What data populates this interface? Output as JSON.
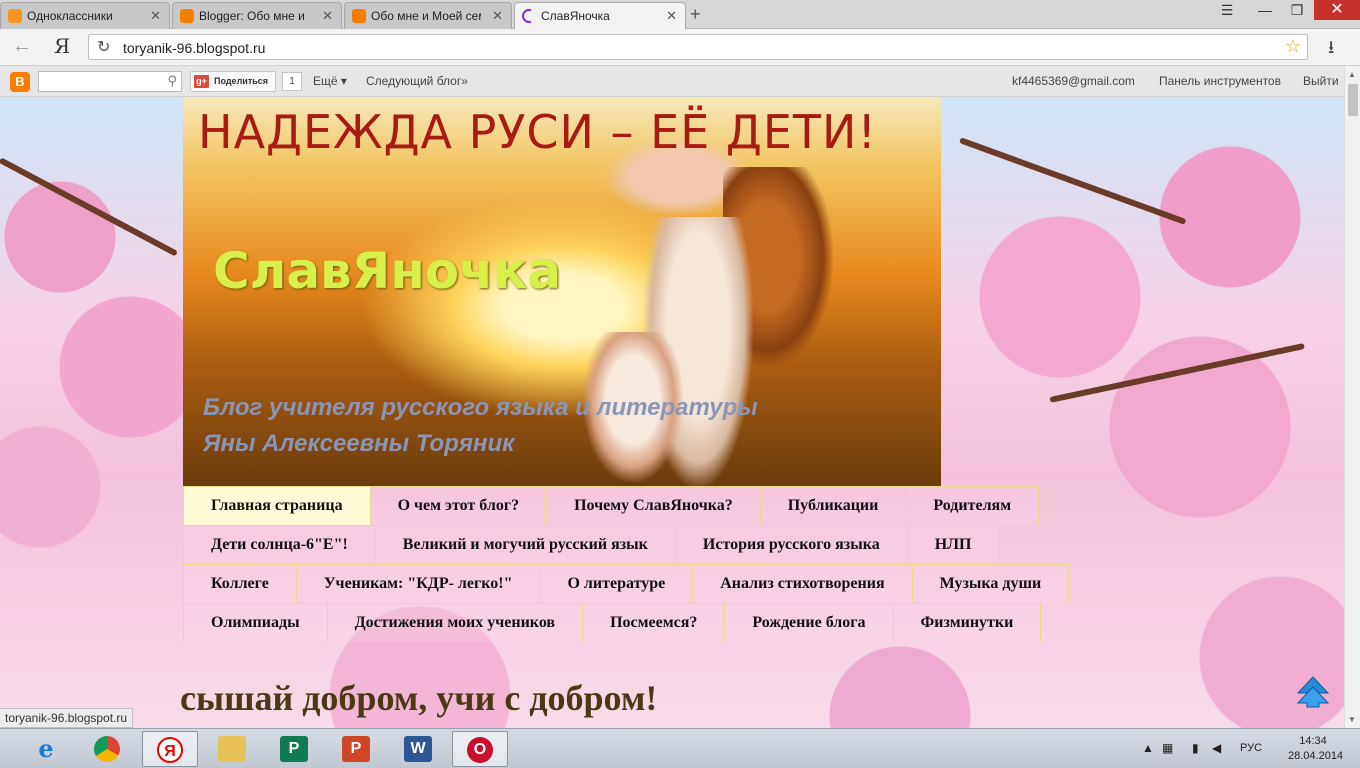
{
  "browser": {
    "tabs": [
      {
        "title": "Одноклассники",
        "active": false
      },
      {
        "title": "Blogger: Обо мне и М",
        "active": false
      },
      {
        "title": "Обо мне и Моей сем",
        "active": false
      },
      {
        "title": "СлавЯночка",
        "active": true
      }
    ],
    "new_tab": "+",
    "address": "toryanik-96.blogspot.ru",
    "yandex_logo": "Я"
  },
  "navbar": {
    "logo": "B",
    "share_label": "Поделиться",
    "share_count": "1",
    "more_label": "Ещё ▾",
    "next_blog": "Следующий блог»",
    "email": "kf4465369@gmail.com",
    "dashboard": "Панель инструментов",
    "logout": "Выйти"
  },
  "header": {
    "title_top": "НАДЕЖДА РУСИ – ЕЁ ДЕТИ!",
    "blog_name": "СлавЯночка",
    "subtitle_1": "Блог учителя русского языка и литературы",
    "subtitle_2": "Яны Алексеевны Торяник"
  },
  "menu": {
    "rows": [
      [
        "Главная страница",
        "О чем этот блог?",
        "Почему СлавЯночка?",
        "Публикации",
        "Родителям"
      ],
      [
        "Дети солнца-6\"Е\"!",
        "Великий и могучий русский язык",
        "История русского языка",
        "НЛП"
      ],
      [
        "Коллеге",
        "Ученикам: \"КДР- легко!\"",
        "О литературе",
        "Анализ стихотворения",
        "Музыка души"
      ],
      [
        "Олимпиады",
        "Достижения моих учеников",
        "Посмеемся?",
        "Рождение блога",
        "Физминутки"
      ]
    ],
    "active": "Главная страница"
  },
  "post": {
    "title": "сышай добром, учи с добром!"
  },
  "status_url": "toryanik-96.blogspot.ru",
  "taskbar": {
    "lang": "РУС",
    "time": "14:34",
    "date": "28.04.2014"
  },
  "colors": {
    "title_red": "#a81a12",
    "blog_name_yellow": "#d8f04a",
    "menu_border": "#e8d98a",
    "menu_active_bg": "#fffbd9"
  }
}
